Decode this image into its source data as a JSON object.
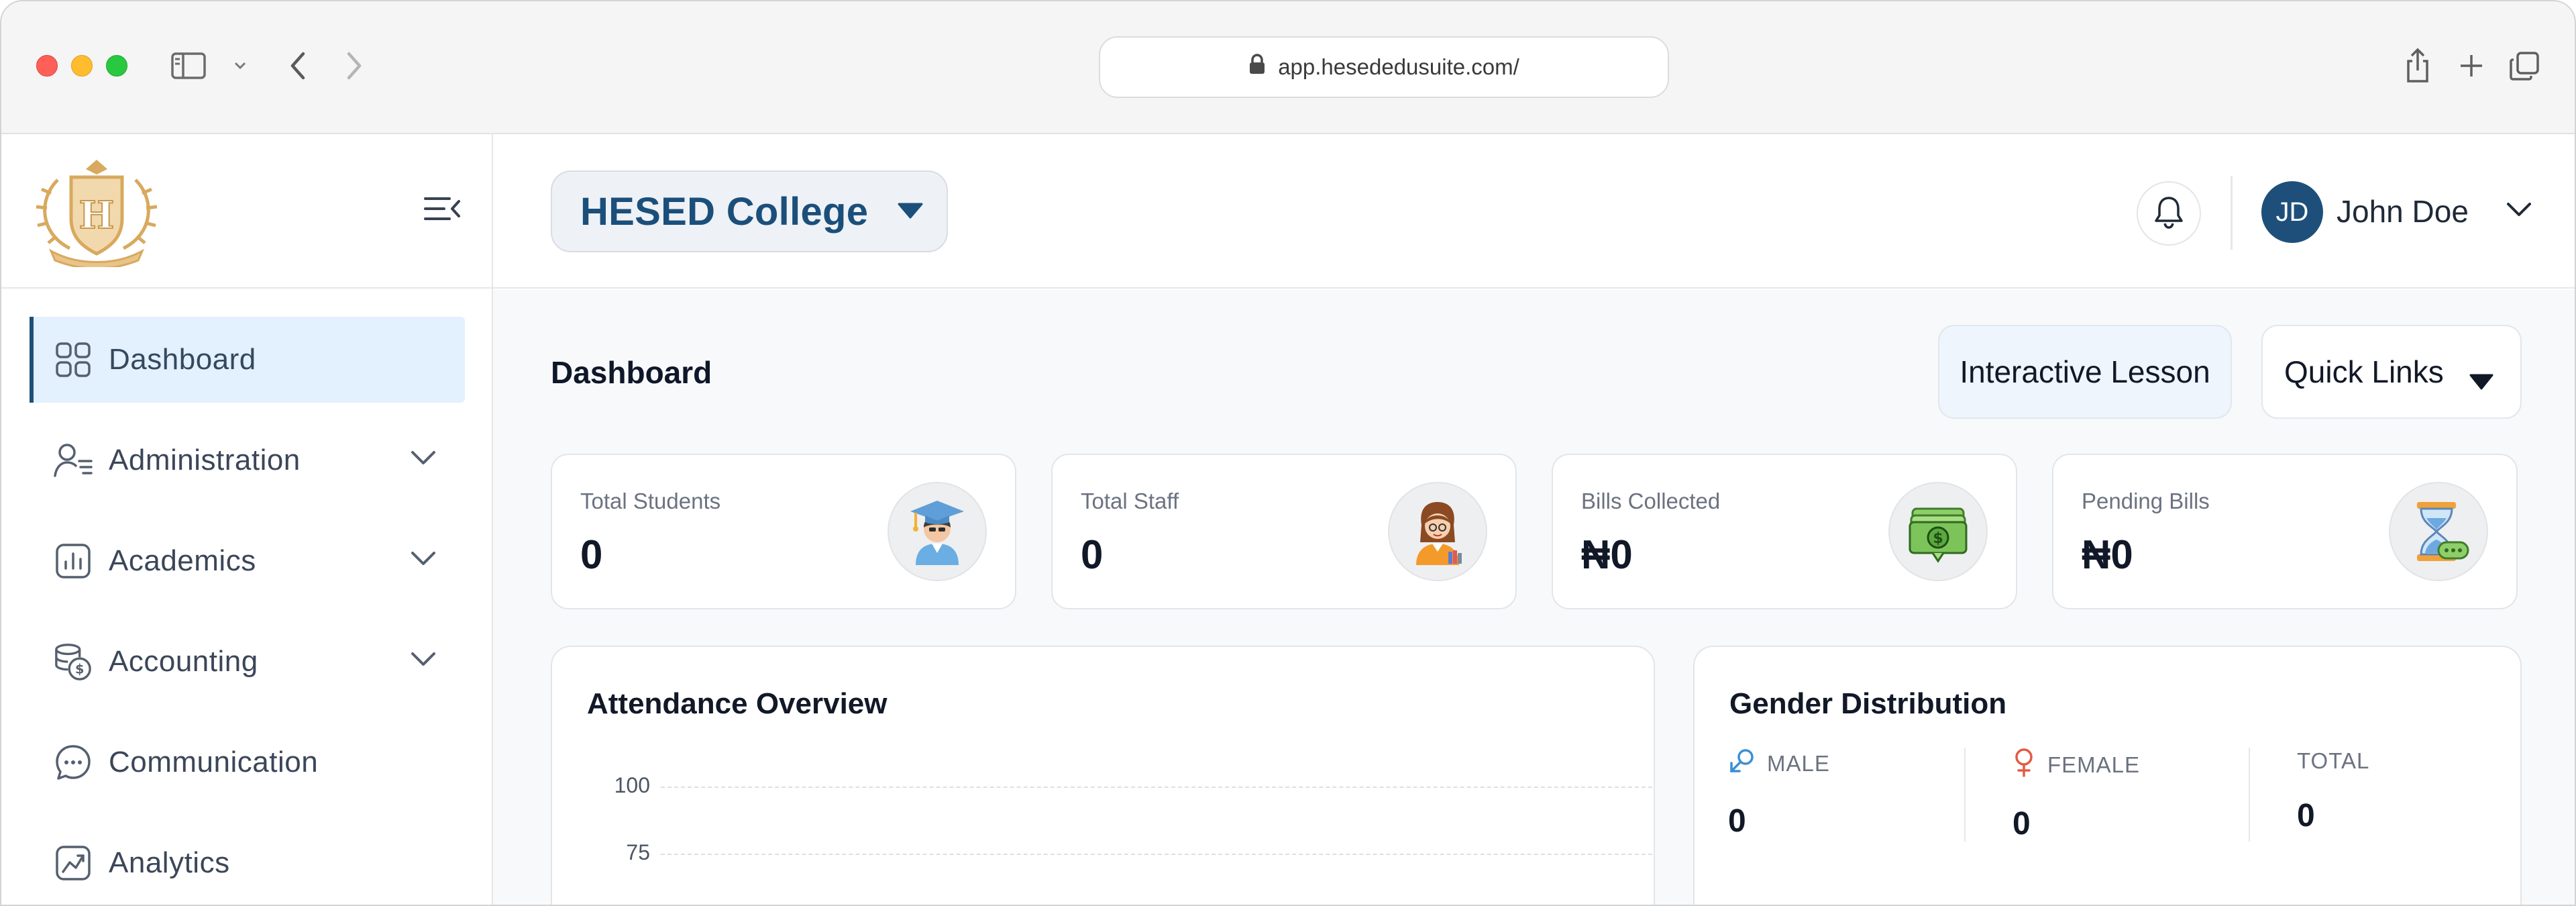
{
  "browser": {
    "url": "app.hesededusuite.com/"
  },
  "sidebar": {
    "logo_letter": "H",
    "items": [
      {
        "label": "Dashboard",
        "icon": "grid-icon",
        "active": true
      },
      {
        "label": "Administration",
        "icon": "user-list-icon",
        "expandable": true
      },
      {
        "label": "Academics",
        "icon": "bar-chart-icon",
        "expandable": true
      },
      {
        "label": "Accounting",
        "icon": "coins-icon",
        "expandable": true
      },
      {
        "label": "Communication",
        "icon": "chat-icon"
      },
      {
        "label": "Analytics",
        "icon": "analytics-icon"
      }
    ]
  },
  "header": {
    "school": "HESED College",
    "user": {
      "initials": "JD",
      "name": "John Doe"
    }
  },
  "main": {
    "title": "Dashboard",
    "interactive_lesson": "Interactive Lesson",
    "quick_links": "Quick Links",
    "stats": [
      {
        "label": "Total Students",
        "value": "0",
        "icon": "graduate-icon"
      },
      {
        "label": "Total Staff",
        "value": "0",
        "icon": "teacher-icon"
      },
      {
        "label": "Bills Collected",
        "value": "₦0",
        "icon": "cash-icon"
      },
      {
        "label": "Pending Bills",
        "value": "₦0",
        "icon": "hourglass-icon"
      }
    ],
    "attendance": {
      "title": "Attendance Overview",
      "y_ticks": [
        "100",
        "75"
      ]
    },
    "gender": {
      "title": "Gender Distribution",
      "male_label": "MALE",
      "male_value": "0",
      "female_label": "FEMALE",
      "female_value": "0",
      "total_label": "TOTAL",
      "total_value": "0"
    }
  },
  "colors": {
    "brand": "#1d4f7a",
    "active_bg": "#e3f0fd",
    "male": "#3b8fd4",
    "female": "#e25b45"
  }
}
